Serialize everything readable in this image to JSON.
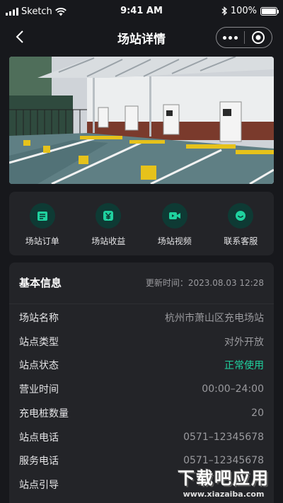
{
  "status_bar": {
    "carrier": "Sketch",
    "time": "9:41 AM",
    "battery": "100%"
  },
  "nav": {
    "title": "场站详情"
  },
  "actions": [
    {
      "label": "场站订单",
      "icon": "order-icon"
    },
    {
      "label": "场站收益",
      "icon": "yuan-icon"
    },
    {
      "label": "场站视频",
      "icon": "video-icon"
    },
    {
      "label": "联系客服",
      "icon": "service-icon"
    }
  ],
  "info": {
    "title": "基本信息",
    "update_time": "更新时间：2023.08.03 12:28",
    "rows": [
      {
        "key": "场站名称",
        "value": "杭州市萧山区充电场站"
      },
      {
        "key": "站点类型",
        "value": "对外开放"
      },
      {
        "key": "站点状态",
        "value": "正常使用"
      },
      {
        "key": "营业时间",
        "value": "00:00–24:00"
      },
      {
        "key": "充电桩数量",
        "value": "20"
      },
      {
        "key": "站点电话",
        "value": "0571–12345678"
      },
      {
        "key": "服务电话",
        "value": "0571–12345678"
      },
      {
        "key": "站点引导",
        "value": ""
      }
    ]
  },
  "watermark": {
    "main": "下载吧应用",
    "sub": "www.xiazaiba.com"
  },
  "colors": {
    "accent": "#1fd29f",
    "background": "#17181c",
    "card": "#232428"
  }
}
